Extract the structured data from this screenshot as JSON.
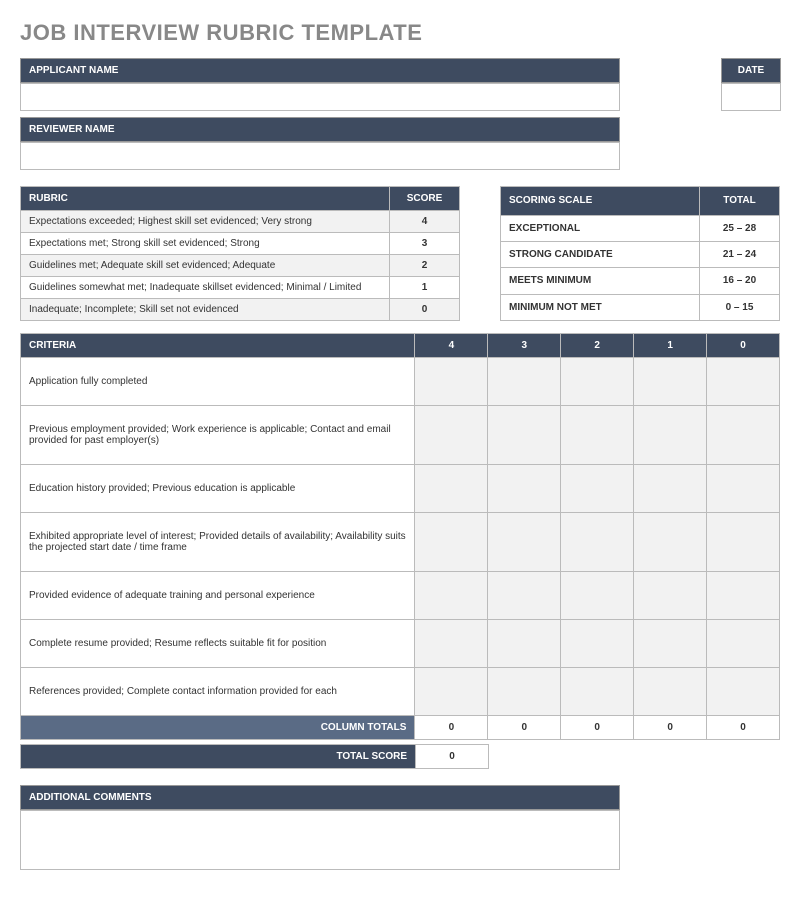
{
  "title": "JOB INTERVIEW RUBRIC TEMPLATE",
  "labels": {
    "applicant_name": "APPLICANT NAME",
    "date": "DATE",
    "reviewer_name": "REVIEWER NAME",
    "rubric": "RUBRIC",
    "score": "SCORE",
    "scoring_scale": "SCORING SCALE",
    "total": "TOTAL",
    "criteria": "CRITERIA",
    "column_totals": "COLUMN TOTALS",
    "total_score": "TOTAL SCORE",
    "additional_comments": "ADDITIONAL COMMENTS"
  },
  "rubric": [
    {
      "desc": "Expectations exceeded; Highest skill set evidenced; Very strong",
      "score": "4"
    },
    {
      "desc": "Expectations met; Strong skill set evidenced; Strong",
      "score": "3"
    },
    {
      "desc": "Guidelines met; Adequate skill set evidenced; Adequate",
      "score": "2"
    },
    {
      "desc": "Guidelines somewhat met; Inadequate skillset evidenced; Minimal / Limited",
      "score": "1"
    },
    {
      "desc": "Inadequate; Incomplete; Skill set not evidenced",
      "score": "0"
    }
  ],
  "scale": [
    {
      "label": "EXCEPTIONAL",
      "range": "25 – 28"
    },
    {
      "label": "STRONG CANDIDATE",
      "range": "21 – 24"
    },
    {
      "label": "MEETS MINIMUM",
      "range": "16 – 20"
    },
    {
      "label": "MINIMUM NOT MET",
      "range": "0 – 15"
    }
  ],
  "criteria_headers": [
    "4",
    "3",
    "2",
    "1",
    "0"
  ],
  "criteria": [
    "Application fully completed",
    "Previous employment provided; Work experience is applicable; Contact and email provided for past employer(s)",
    "Education history provided; Previous education is applicable",
    "Exhibited appropriate level of interest; Provided details of availability; Availability suits the projected start date / time frame",
    "Provided evidence of adequate training and personal experience",
    "Complete resume provided; Resume reflects suitable fit for position",
    "References provided; Complete contact information provided for each"
  ],
  "column_totals": [
    "0",
    "0",
    "0",
    "0",
    "0"
  ],
  "total_score": "0"
}
